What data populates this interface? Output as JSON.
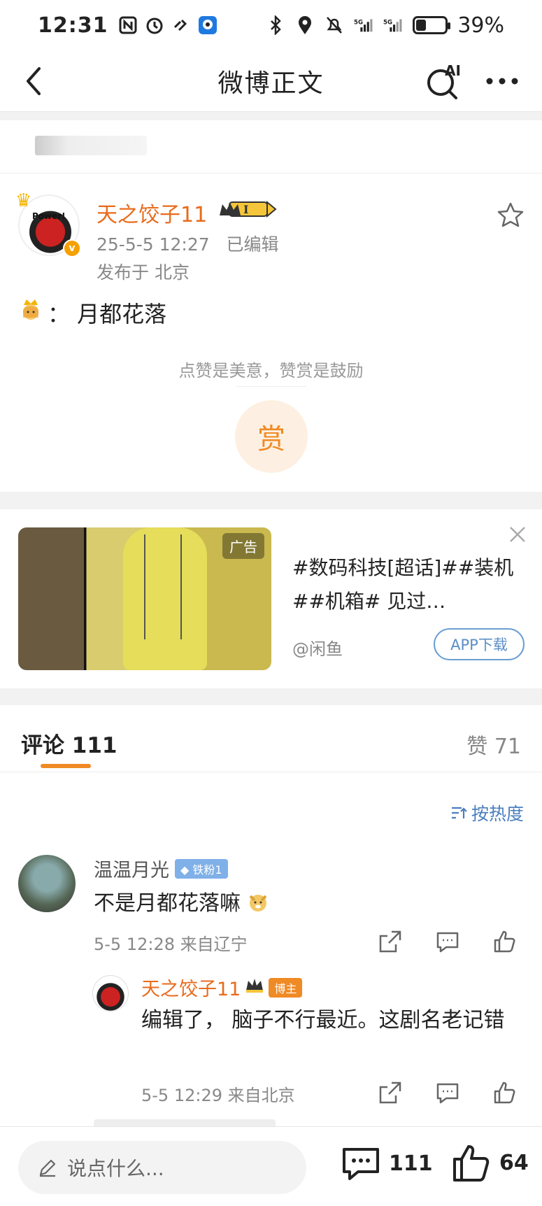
{
  "status_bar": {
    "time": "12:31",
    "battery": "39%",
    "network": "5G"
  },
  "nav": {
    "title": "微博正文",
    "ai_label": "AI"
  },
  "post": {
    "author": "天之饺子11",
    "level": "I",
    "avatar_text": "Power!",
    "time": "25-5-5 12:27",
    "edited": "已编辑",
    "location": "发布于 北京",
    "content": "： 月都花落",
    "reward_hint": "点赞是美意，赞赏是鼓励",
    "reward_button": "赏"
  },
  "ad": {
    "tag": "广告",
    "title": "#数码科技[超话]##装机##机箱# 见过…",
    "source": "@闲鱼",
    "button": "APP下载"
  },
  "comments_header": {
    "tab": "评论 111",
    "likes": "赞 71"
  },
  "sort_label": "按热度",
  "comments": [
    {
      "user": "温温月光",
      "badge": "铁粉1",
      "text": "不是月都花落嘛",
      "meta": "5-5 12:28  来自辽宁"
    }
  ],
  "reply": {
    "user": "天之饺子11",
    "badge": "博主",
    "text": "编辑了， 脑子不行最近。这剧名老记错",
    "meta": "5-5 12:29  来自北京"
  },
  "bottom_bar": {
    "input_placeholder": "说点什么...",
    "comment_count": "111",
    "like_count": "64"
  },
  "colors": {
    "accent": "#f08a24",
    "author": "#e86b1c",
    "link": "#4a7fbf"
  }
}
